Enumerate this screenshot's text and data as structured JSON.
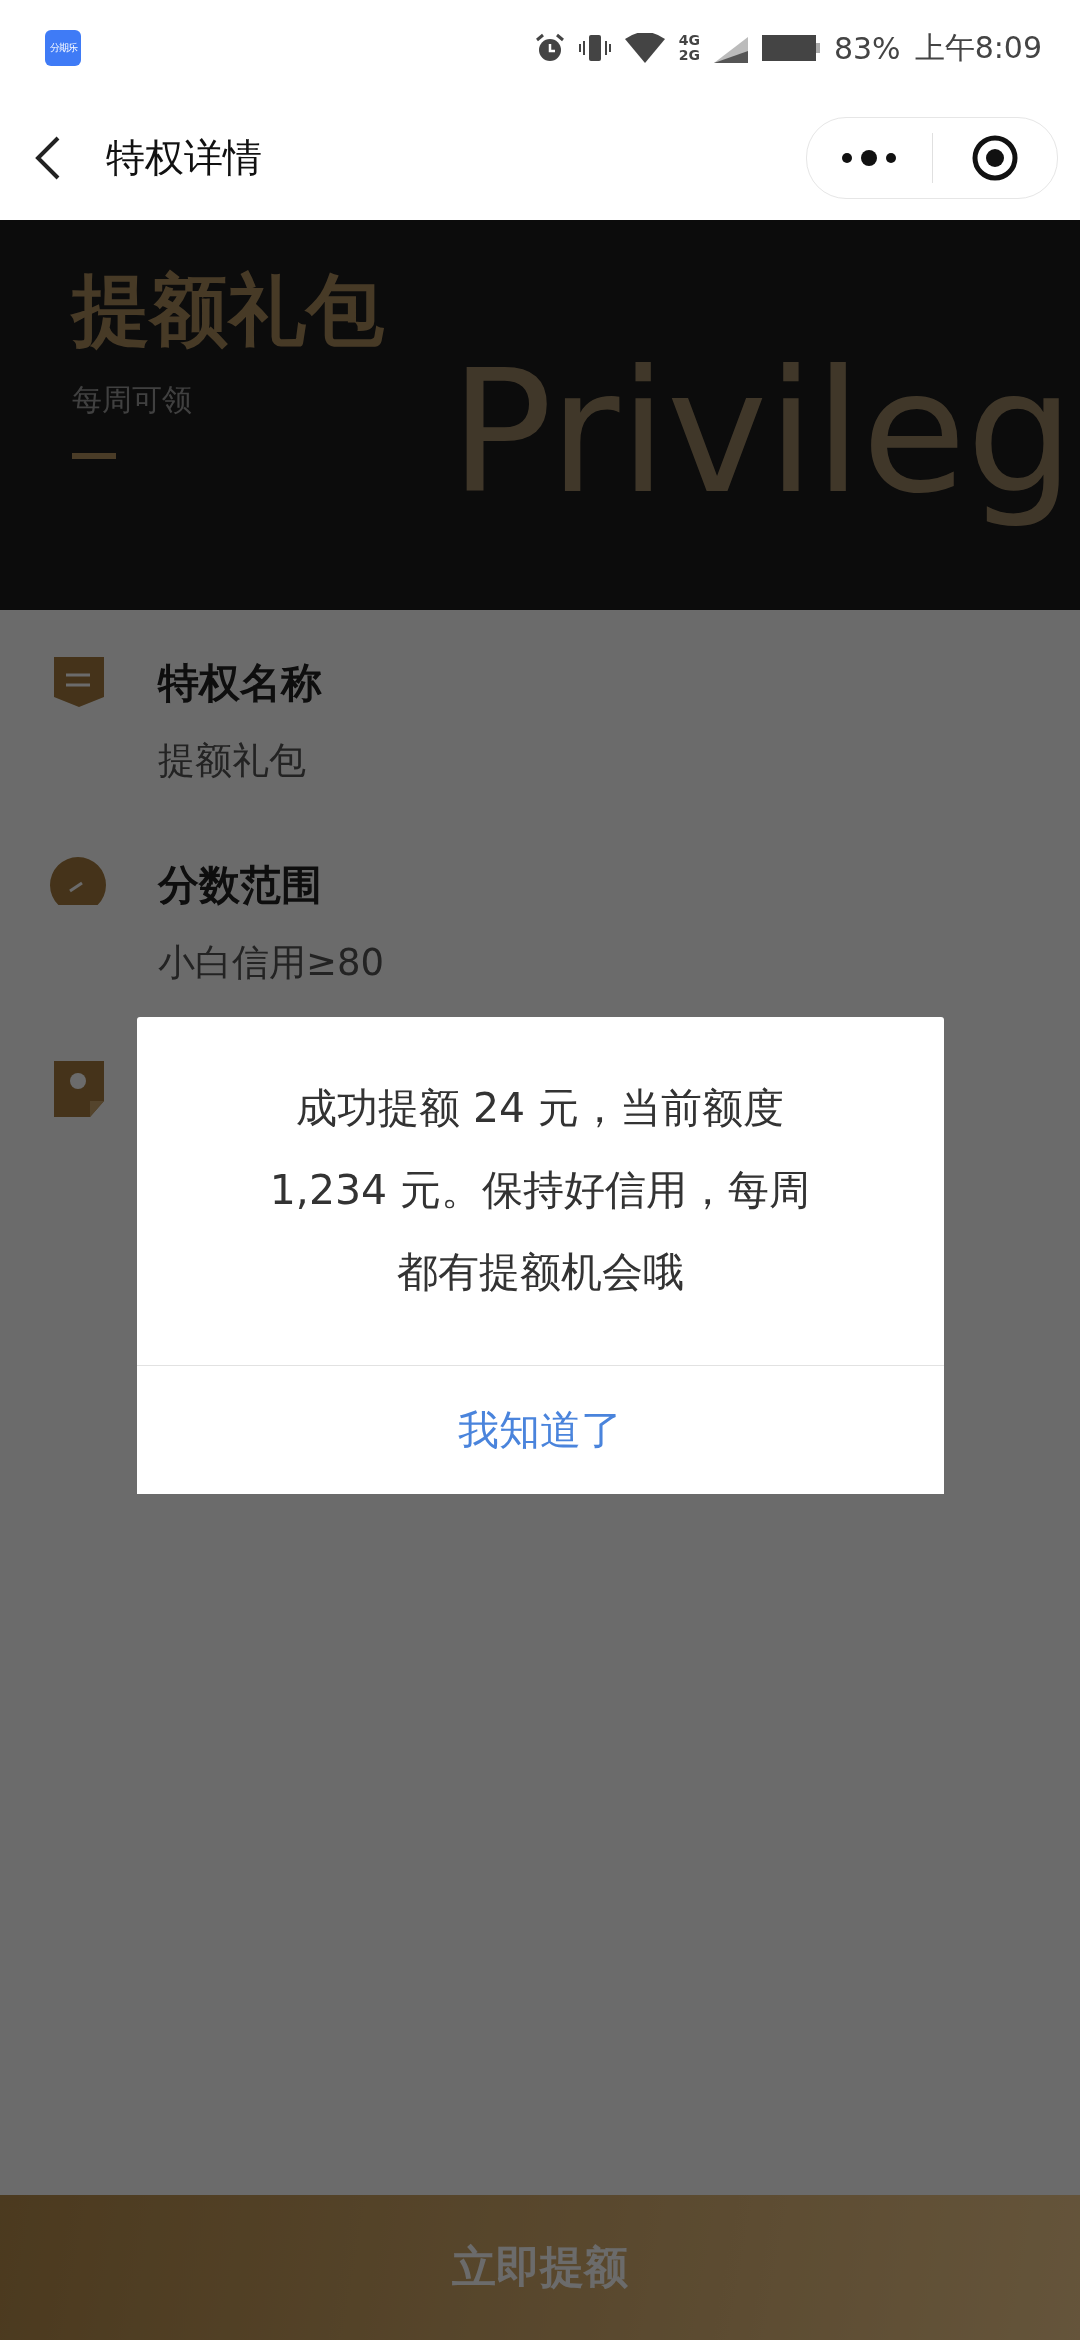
{
  "status_bar": {
    "app_icon_label": "分期乐",
    "network_top": "4G",
    "network_bottom": "2G",
    "battery": "83%",
    "time": "上午8:09"
  },
  "nav_bar": {
    "title": "特权详情"
  },
  "hero": {
    "title": "提额礼包",
    "subtitle": "每周可领",
    "watermark": "Privileg"
  },
  "details": [
    {
      "title": "特权名称",
      "value": "提额礼包"
    },
    {
      "title": "分数范围",
      "value": "小白信用≥80"
    }
  ],
  "dialog": {
    "message": "成功提额 24 元，当前额度 1,234 元。保持好信用，每周都有提额机会哦",
    "button": "我知道了"
  },
  "bottom_button": {
    "label": "立即提额"
  }
}
